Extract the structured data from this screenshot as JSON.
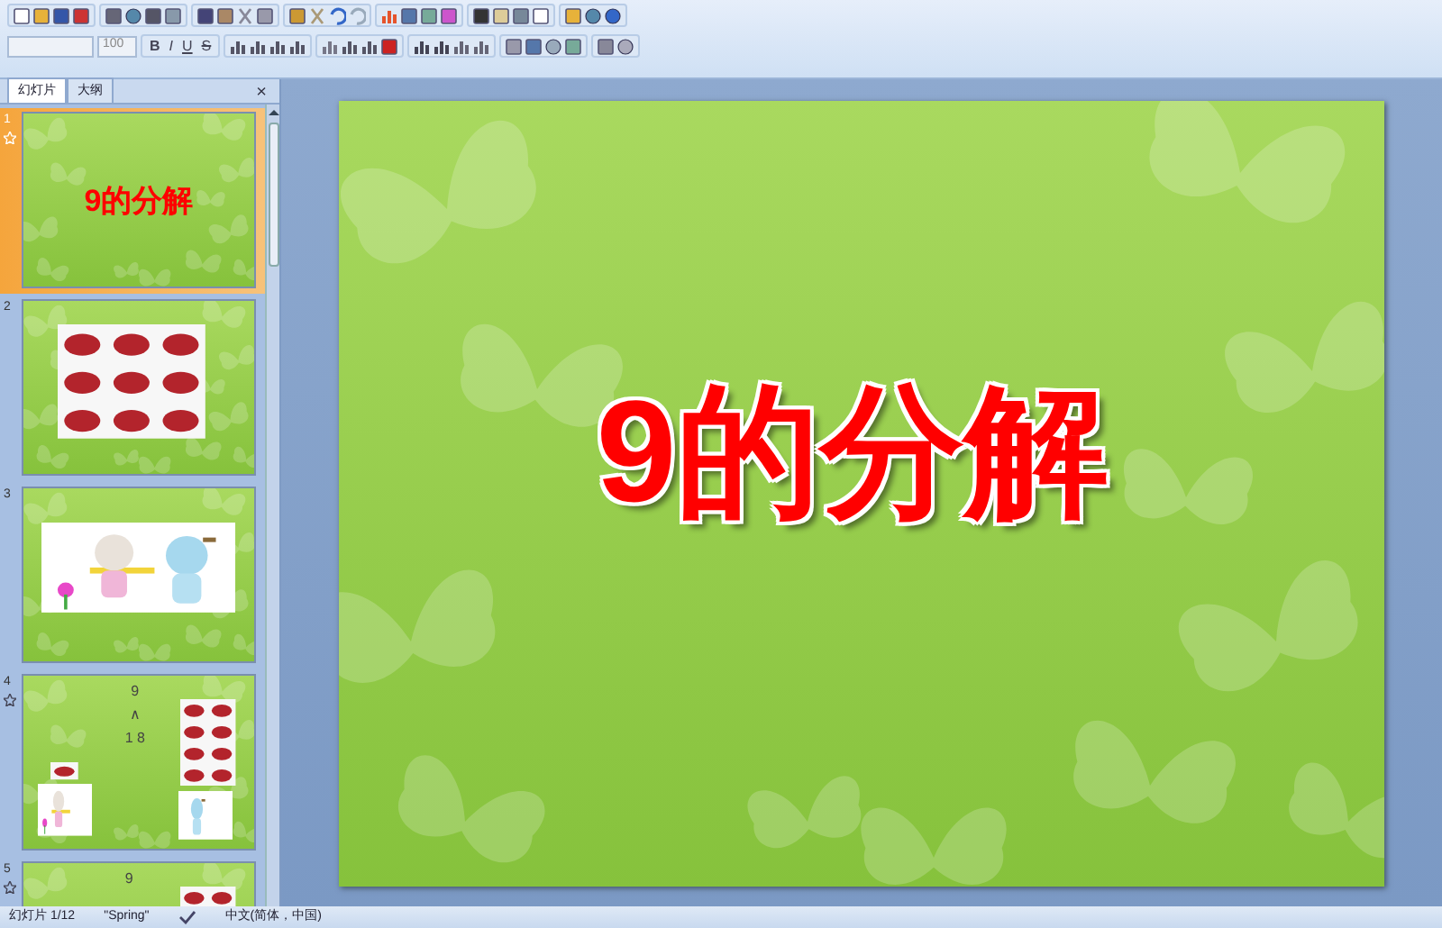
{
  "toolbar": {
    "font_size": "100",
    "format_buttons": [
      "B",
      "I",
      "U",
      "S"
    ]
  },
  "panel": {
    "tabs": [
      {
        "label": "幻灯片",
        "selected": true
      },
      {
        "label": "大纲",
        "selected": false
      }
    ],
    "close": "×"
  },
  "slides": [
    {
      "number": "1",
      "selected": true,
      "animated": true,
      "kind": "title",
      "title": "9的分解"
    },
    {
      "number": "2",
      "selected": false,
      "animated": false,
      "kind": "photo-grid"
    },
    {
      "number": "3",
      "selected": false,
      "animated": false,
      "kind": "cartoon"
    },
    {
      "number": "4",
      "selected": false,
      "animated": true,
      "kind": "decomposition",
      "lines": [
        "9",
        "∧",
        "1 8"
      ]
    },
    {
      "number": "5",
      "selected": false,
      "animated": true,
      "kind": "decomposition",
      "lines": [
        "9"
      ]
    }
  ],
  "main_slide": {
    "title": "9的分解"
  },
  "status_bar": {
    "slide": "幻灯片 1/12",
    "theme": "\"Spring\"",
    "language": "中文(简体，中国)"
  }
}
